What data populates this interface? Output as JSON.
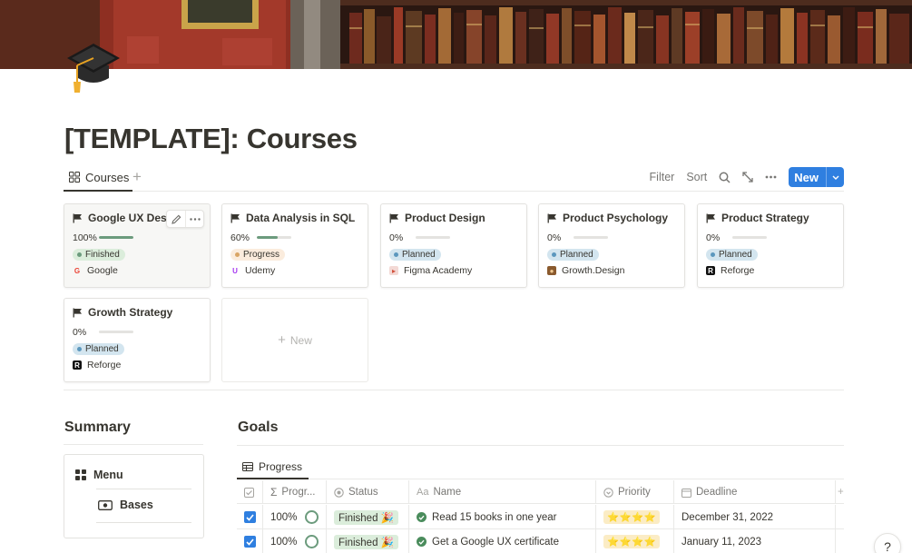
{
  "page": {
    "title": "[TEMPLATE]: Courses",
    "icon": "graduation-cap-icon"
  },
  "view": {
    "tab_label": "Courses",
    "toolbar": {
      "filter": "Filter",
      "sort": "Sort",
      "new": "New"
    }
  },
  "cards": [
    {
      "title": "Google UX Design",
      "progress_text": "100%",
      "progress": 1.0,
      "status": "Finished",
      "source": "Google",
      "logo": "google-logo-icon"
    },
    {
      "title": "Data Analysis in SQL",
      "progress_text": "60%",
      "progress": 0.6,
      "status": "Progress",
      "source": "Udemy",
      "logo": "udemy-logo-icon"
    },
    {
      "title": "Product Design",
      "progress_text": "0%",
      "progress": 0,
      "status": "Planned",
      "source": "Figma Academy",
      "logo": "figma-academy-logo-icon"
    },
    {
      "title": "Product Psychology",
      "progress_text": "0%",
      "progress": 0,
      "status": "Planned",
      "source": "Growth.Design",
      "logo": "growth-design-logo-icon"
    },
    {
      "title": "Product Strategy",
      "progress_text": "0%",
      "progress": 0,
      "status": "Planned",
      "source": "Reforge",
      "logo": "reforge-logo-icon"
    },
    {
      "title": "Growth Strategy",
      "progress_text": "0%",
      "progress": 0,
      "status": "Planned",
      "source": "Reforge",
      "logo": "reforge-logo-icon"
    }
  ],
  "gallery": {
    "new_label": "New"
  },
  "summary": {
    "heading": "Summary",
    "items": [
      {
        "label": "Menu",
        "icon": "grid-icon"
      },
      {
        "label": "Bases",
        "icon": "money-icon"
      }
    ]
  },
  "goals": {
    "heading": "Goals",
    "tab_label": "Progress",
    "columns": [
      "",
      "Progr...",
      "Status",
      "Name",
      "Priority",
      "Deadline"
    ],
    "rows": [
      {
        "checked": true,
        "progress": "100%",
        "status": "Finished 🎉",
        "name": "Read 15 books in one year",
        "priority": "⭐⭐⭐⭐",
        "deadline": "December 31, 2022"
      },
      {
        "checked": true,
        "progress": "100%",
        "status": "Finished 🎉",
        "name": "Get a Google UX certificate",
        "priority": "⭐⭐⭐⭐",
        "deadline": "January 11, 2023"
      }
    ]
  },
  "help": {
    "label": "?"
  },
  "colors": {
    "accent": "#2f7fe0",
    "green": "#6c9b7d",
    "text": "#37352f"
  }
}
